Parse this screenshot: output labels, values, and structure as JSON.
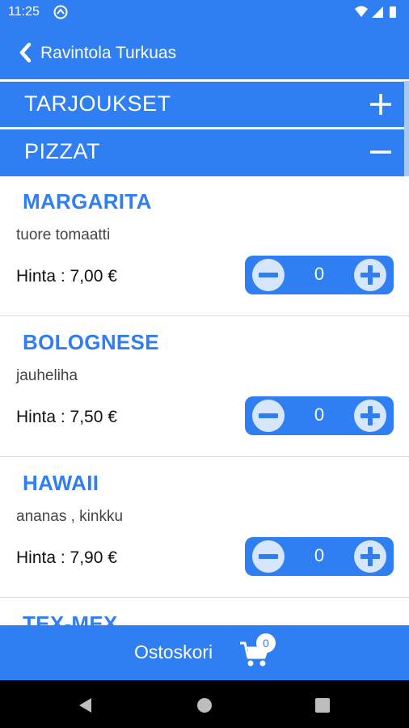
{
  "status_bar": {
    "time": "11:25"
  },
  "app_bar": {
    "title": "Ravintola Turkuas"
  },
  "sections": [
    {
      "label": "TARJOUKSET",
      "toggle_icon": "plus-icon"
    },
    {
      "label": "PIZZAT",
      "toggle_icon": "minus-icon"
    }
  ],
  "menu": {
    "items": [
      {
        "name": "MARGARITA",
        "description": "tuore tomaatti",
        "price": "Hinta : 7,00 €",
        "quantity": "0"
      },
      {
        "name": "BOLOGNESE",
        "description": "jauheliha",
        "price": "Hinta : 7,50 €",
        "quantity": "0"
      },
      {
        "name": "HAWAII",
        "description": "ananas ,  kinkku",
        "price": "Hinta : 7,90 €",
        "quantity": "0"
      }
    ],
    "partial_item_name": "TEX-MEX"
  },
  "cart": {
    "label": "Ostoskori",
    "count": "0"
  },
  "colors": {
    "accent": "#2f7ef2",
    "button_circle": "#d6e6fc"
  }
}
